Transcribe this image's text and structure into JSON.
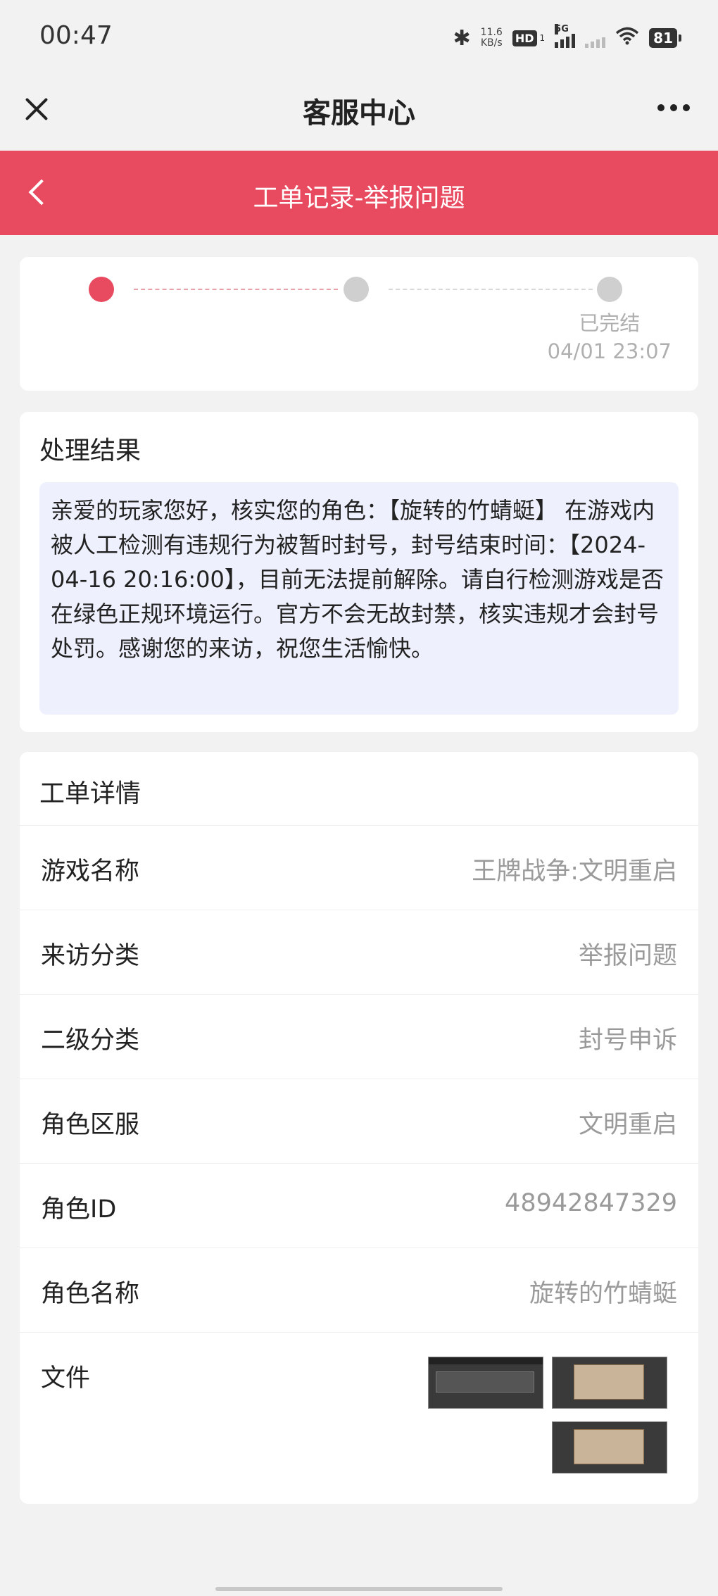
{
  "status_bar": {
    "time": "00:47",
    "net_speed_value": "11.6",
    "net_speed_unit": "KB/s",
    "hd_badge": "HD",
    "hd_sub": "1",
    "network": "5G",
    "battery": "81"
  },
  "app": {
    "title": "客服中心"
  },
  "header": {
    "title": "工单记录-举报问题",
    "color": "#e84a5f"
  },
  "progress": {
    "steps": [
      {
        "state": "active"
      },
      {
        "state": "inactive"
      },
      {
        "state": "inactive",
        "label": "已完结",
        "time": "04/01 23:07"
      }
    ]
  },
  "result": {
    "title": "处理结果",
    "message": "亲爱的玩家您好，核实您的角色：【旋转的竹蜻蜓】 在游戏内被人工检测有违规行为被暂时封号，封号结束时间：【2024-04-16 20:16:00】，目前无法提前解除。请自行检测游戏是否在绿色正规环境运行。官方不会无故封禁，核实违规才会封号处罚。感谢您的来访，祝您生活愉快。"
  },
  "details": {
    "title": "工单详情",
    "rows": [
      {
        "label": "游戏名称",
        "value": "王牌战争:文明重启"
      },
      {
        "label": "来访分类",
        "value": "举报问题"
      },
      {
        "label": "二级分类",
        "value": "封号申诉"
      },
      {
        "label": "角色区服",
        "value": "文明重启"
      },
      {
        "label": "角色ID",
        "value": "48942847329"
      },
      {
        "label": "角色名称",
        "value": "旋转的竹蜻蜓"
      }
    ],
    "file_label": "文件"
  }
}
